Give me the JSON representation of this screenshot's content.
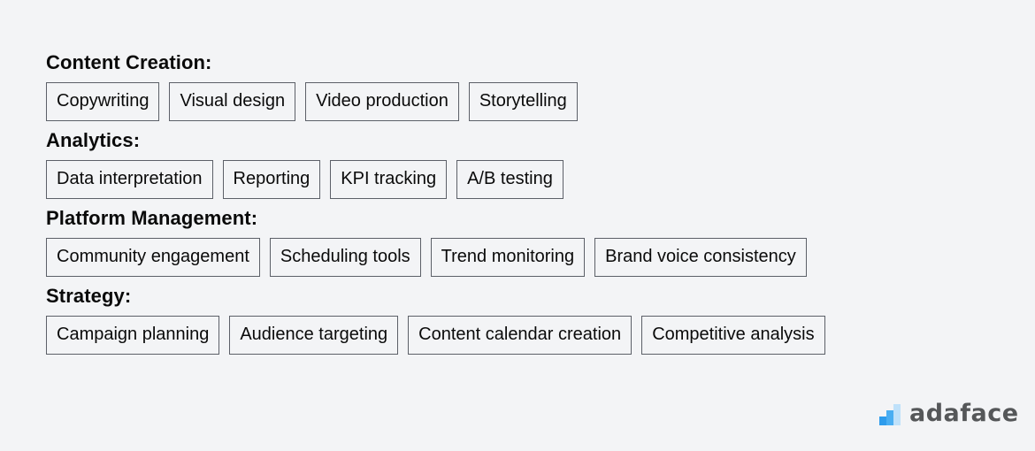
{
  "groups": [
    {
      "title": "Content Creation:",
      "tags": [
        "Copywriting",
        "Visual design",
        "Video production",
        "Storytelling"
      ]
    },
    {
      "title": "Analytics:",
      "tags": [
        "Data interpretation",
        "Reporting",
        "KPI tracking",
        "A/B testing"
      ]
    },
    {
      "title": "Platform Management:",
      "tags": [
        "Community engagement",
        "Scheduling tools",
        "Trend monitoring",
        "Brand voice consistency"
      ]
    },
    {
      "title": "Strategy:",
      "tags": [
        "Campaign planning",
        "Audience targeting",
        "Content calendar creation",
        "Competitive analysis"
      ]
    }
  ],
  "logo": {
    "text": "adaface",
    "icon": "bar-chart-steps-icon"
  }
}
